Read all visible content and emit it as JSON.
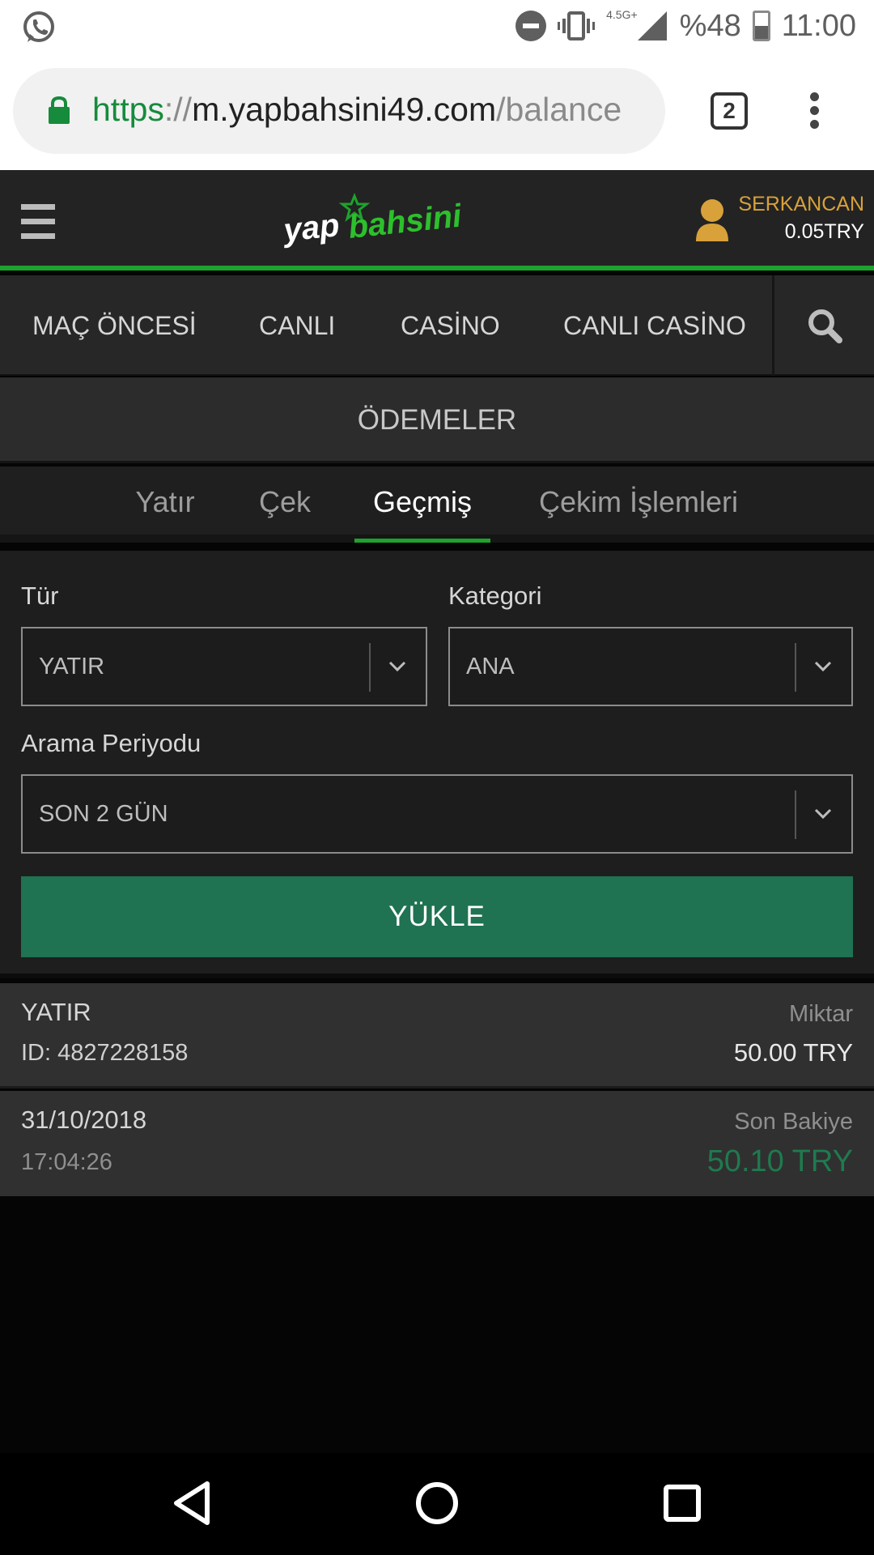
{
  "status_bar": {
    "network": "4.5G+",
    "battery": "%48",
    "time": "11:00",
    "icons": [
      "whatsapp-icon",
      "do-not-disturb-icon",
      "vibrate-icon",
      "signal-icon",
      "battery-icon"
    ]
  },
  "browser": {
    "url_scheme": "https",
    "url_sep": "://",
    "url_host": "m.yapbahsini49.com",
    "url_path": "/balance",
    "tab_count": "2"
  },
  "header": {
    "logo": "yapbahsini",
    "username": "SERKANCAN",
    "balance": "0.05TRY"
  },
  "nav": {
    "items": [
      "MAÇ ÖNCESİ",
      "CANLI",
      "CASİNO",
      "CANLI CASİNO"
    ]
  },
  "section_title": "ÖDEMELER",
  "subtabs": {
    "items": [
      "Yatır",
      "Çek",
      "Geçmiş",
      "Çekim İşlemleri"
    ],
    "active": "Geçmiş"
  },
  "form": {
    "type_label": "Tür",
    "type_value": "YATIR",
    "category_label": "Kategori",
    "category_value": "ANA",
    "period_label": "Arama Periyodu",
    "period_value": "SON 2 GÜN",
    "load_button": "YÜKLE"
  },
  "transactions": [
    {
      "type": "YATIR",
      "id": "ID: 4827228158",
      "amount_label": "Miktar",
      "amount": "50.00 TRY",
      "date": "31/10/2018",
      "time": "17:04:26",
      "balance_label": "Son Bakiye",
      "balance": "50.10 TRY"
    }
  ],
  "colors": {
    "accent_green": "#1ea22d",
    "button_green": "#1f7252",
    "username_gold": "#d8a13a",
    "balance_green": "#1f7a4f"
  }
}
